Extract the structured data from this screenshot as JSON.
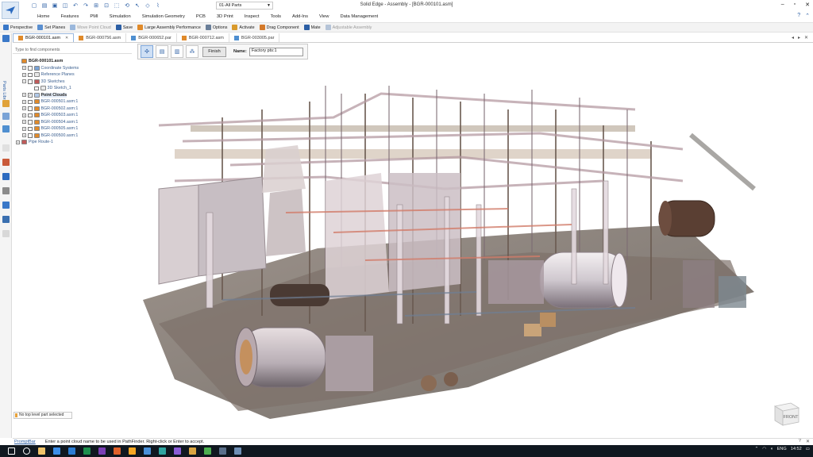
{
  "window": {
    "title": "Solid Edge - Assembly - [BGR-000101.asm]",
    "controls": [
      "–",
      "▫",
      "✕"
    ]
  },
  "quick_access": {
    "document_selector": "01-All Parts"
  },
  "ribbon": {
    "tabs": [
      "Home",
      "Features",
      "PMI",
      "Simulation",
      "Simulation Geometry",
      "PCB",
      "3D Print",
      "Inspect",
      "Tools",
      "Add-Ins",
      "View",
      "Data Management"
    ]
  },
  "command_bar": {
    "items": [
      {
        "label": "Perspective",
        "enabled": true,
        "color": "#3a78c8"
      },
      {
        "label": "Set Planes",
        "enabled": true,
        "color": "#5a8fd0"
      },
      {
        "label": "Move Point Cloud",
        "enabled": false,
        "color": "#9bb8dc"
      },
      {
        "label": "Save",
        "enabled": true,
        "color": "#2c5fa5"
      },
      {
        "label": "Large Assembly Performance",
        "enabled": true,
        "color": "#e08a2a"
      },
      {
        "label": "Options",
        "enabled": true,
        "color": "#6a7f99"
      },
      {
        "label": "Activate",
        "enabled": true,
        "color": "#d99a2b"
      },
      {
        "label": "Drag Component",
        "enabled": true,
        "color": "#d47a2a"
      },
      {
        "label": "Mate",
        "enabled": true,
        "color": "#2c5fa5"
      },
      {
        "label": "Adjustable Assembly",
        "enabled": false,
        "color": "#b5c4d8"
      }
    ]
  },
  "doc_tabs": [
    {
      "label": "BGR-000101.asm",
      "active": true
    },
    {
      "label": "BGR-000756.asm",
      "active": false
    },
    {
      "label": "BGR-000652.par",
      "active": false
    },
    {
      "label": "BGR-000712.asm",
      "active": false
    },
    {
      "label": "BGR-003005.par",
      "active": false
    }
  ],
  "left_rail": {
    "label": "Parts Library"
  },
  "pathfinder": {
    "search_placeholder": "Type to find components",
    "rows": [
      {
        "label": "BGR-000101.asm",
        "level": 0,
        "bold": true,
        "checkbox": false,
        "checked": false,
        "expander": "",
        "icon": "#e08a2a"
      },
      {
        "label": "Coordinate Systems",
        "level": 1,
        "checkbox": true,
        "checked": false,
        "expander": "+",
        "icon": "#7aa3d6",
        "muted": true
      },
      {
        "label": "Reference Planes",
        "level": 1,
        "checkbox": true,
        "checked": false,
        "expander": "+",
        "icon": "#e8e8e8",
        "muted": true
      },
      {
        "label": "3D Sketches",
        "level": 1,
        "checkbox": true,
        "checked": false,
        "expander": "−",
        "icon": "#c05a5a",
        "muted": true
      },
      {
        "label": "3D Sketch_1",
        "level": 2,
        "checkbox": true,
        "checked": false,
        "expander": "",
        "icon": "#e8e8e8",
        "muted": true
      },
      {
        "label": "Point Clouds",
        "level": 1,
        "checkbox": true,
        "checked": true,
        "expander": "+",
        "icon": "#b0c8e8",
        "bold": true,
        "highlight": true
      },
      {
        "label": "BGR-000501.asm:1",
        "level": 1,
        "checkbox": true,
        "checked": false,
        "expander": "+",
        "icon": "#e08a2a",
        "muted": true
      },
      {
        "label": "BGR-000502.asm:1",
        "level": 1,
        "checkbox": true,
        "checked": false,
        "expander": "+",
        "icon": "#e08a2a",
        "muted": true
      },
      {
        "label": "BGR-000503.asm:1",
        "level": 1,
        "checkbox": true,
        "checked": false,
        "expander": "+",
        "icon": "#e08a2a",
        "muted": true
      },
      {
        "label": "BGR-000504.asm:1",
        "level": 1,
        "checkbox": true,
        "checked": false,
        "expander": "+",
        "icon": "#e08a2a",
        "muted": true
      },
      {
        "label": "BGR-000505.asm:1",
        "level": 1,
        "checkbox": true,
        "checked": false,
        "expander": "+",
        "icon": "#e08a2a",
        "muted": true
      },
      {
        "label": "BGR-000500.asm:1",
        "level": 1,
        "checkbox": true,
        "checked": false,
        "expander": "+",
        "icon": "#e08a2a",
        "muted": true
      },
      {
        "label": "Pipe Route-1",
        "level": 0,
        "checkbox": false,
        "checked": false,
        "expander": "+",
        "icon": "#c05a5a",
        "muted": true
      }
    ],
    "status": "No top level part selected"
  },
  "float_bar": {
    "finish_label": "Finish",
    "name_label": "Name:",
    "name_value": "Factory pts:1"
  },
  "view_cube": {
    "face": "FRONT"
  },
  "prompt_bar": {
    "label": "PromptBar",
    "text": "Enter a point cloud name to be used in PathFinder. Right-click or Enter to accept."
  },
  "taskbar": {
    "language": "ENG",
    "time": "14:52",
    "icons": [
      "#ffffff",
      "#ffffff",
      "#f0c36a",
      "#3c8ee8",
      "#2b7cd3",
      "#1e8f4e",
      "#7a3fb5",
      "#e0612a",
      "#f5a623",
      "#4a90d9",
      "#2fa4a0",
      "#8a5cd6",
      "#d9a441",
      "#4caf50",
      "#5a6f8a",
      "#6f8fb5"
    ]
  }
}
